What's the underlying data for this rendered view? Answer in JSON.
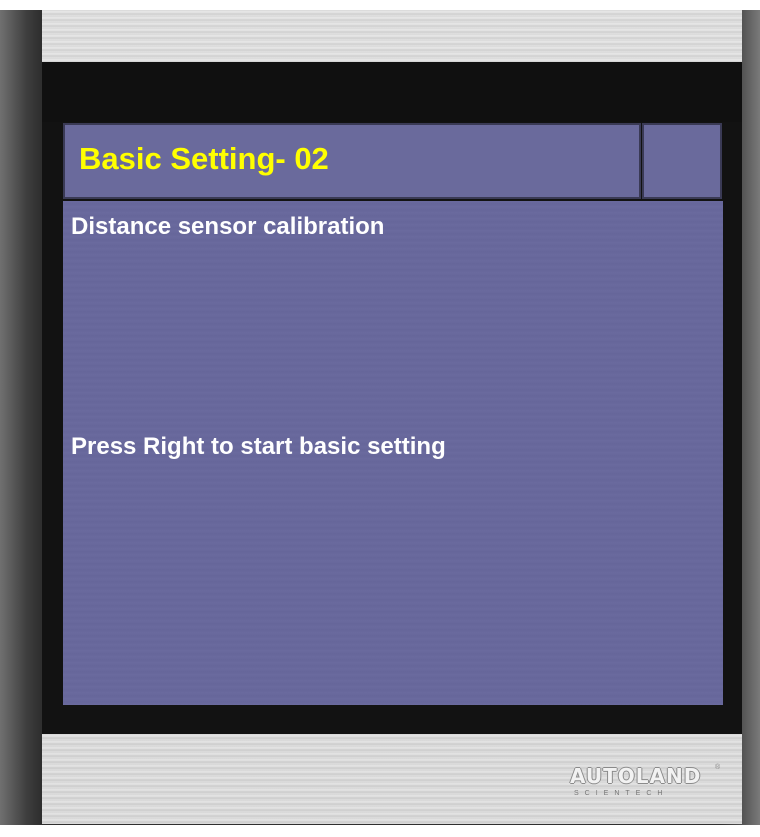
{
  "header": {
    "title": "Basic Setting- 02"
  },
  "content": {
    "description": "Distance sensor calibration",
    "instruction": "Press Right to start basic setting"
  },
  "brand": {
    "logo": "AUTOLAND",
    "tagline": "SCIENTECH",
    "registered": "®"
  },
  "colors": {
    "screen_bg": "#6a6a9c",
    "title_text": "#ffff00",
    "body_text": "#ffffff"
  }
}
